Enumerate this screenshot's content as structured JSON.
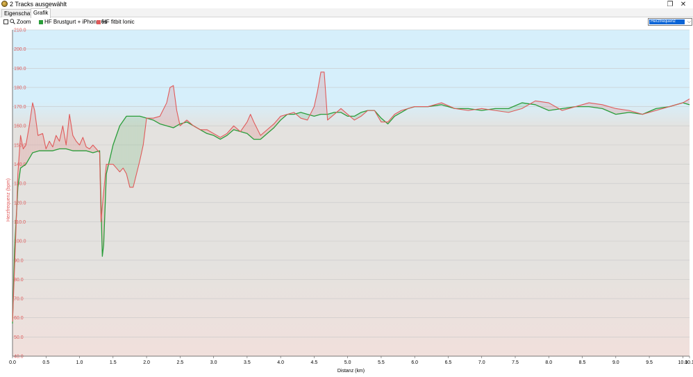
{
  "window": {
    "title": "2 Tracks ausgewählt",
    "icons": {
      "app": "gps-globe-icon",
      "maximize": "restore-window-icon",
      "close": "close-icon"
    }
  },
  "tabs": [
    {
      "label": "Eigenschaften",
      "active": false
    },
    {
      "label": "Grafik",
      "active": true
    }
  ],
  "toolbar": {
    "zoom_label": "Zoom",
    "zoom_checked": false,
    "metric_selected": "Herzfrequenz"
  },
  "colors": {
    "series1": "#2a9d3a",
    "series2": "#e05a5a",
    "band_high": "#d6effb",
    "band_mid": "#e4e2df",
    "band_low": "#f1e0dc",
    "tick_red": "#e05a5a",
    "select_blue": "#0a64d6"
  },
  "chart_data": {
    "type": "line",
    "xlabel": "Distanz  (km)",
    "ylabel": "Herzfrequenz (bpm)",
    "xlim": [
      0,
      10.1
    ],
    "ylim": [
      40,
      210
    ],
    "grid": true,
    "legend_position": "top-left",
    "x_ticks": [
      "0.0",
      "0.5",
      "1.0",
      "1.5",
      "2.0",
      "2.5",
      "3.0",
      "3.5",
      "4.0",
      "4.5",
      "5.0",
      "5.5",
      "6.0",
      "6.5",
      "7.0",
      "7.5",
      "8.0",
      "8.5",
      "9.0",
      "9.5",
      "10.0",
      "10.1"
    ],
    "y_ticks": [
      "40.0",
      "50.0",
      "60.0",
      "70.0",
      "80.0",
      "90.0",
      "100.0",
      "110.0",
      "120.0",
      "130.0",
      "140.0",
      "150.0",
      "160.0",
      "170.0",
      "180.0",
      "190.0",
      "200.0",
      "210.0"
    ],
    "x_tick_values": [
      0,
      0.5,
      1,
      1.5,
      2,
      2.5,
      3,
      3.5,
      4,
      4.5,
      5,
      5.5,
      6,
      6.5,
      7,
      7.5,
      8,
      8.5,
      9,
      9.5,
      10,
      10.1
    ],
    "y_tick_values": [
      40,
      50,
      60,
      70,
      80,
      90,
      100,
      110,
      120,
      130,
      140,
      150,
      160,
      170,
      180,
      190,
      200,
      210
    ],
    "series": [
      {
        "name": "HF Brustgurt + iPhone 6s",
        "x": [
          0,
          0.03,
          0.08,
          0.12,
          0.2,
          0.3,
          0.4,
          0.5,
          0.6,
          0.7,
          0.8,
          0.9,
          1.0,
          1.1,
          1.2,
          1.3,
          1.32,
          1.34,
          1.36,
          1.4,
          1.5,
          1.6,
          1.7,
          1.8,
          1.9,
          2.0,
          2.1,
          2.2,
          2.3,
          2.4,
          2.5,
          2.6,
          2.7,
          2.8,
          2.9,
          3.0,
          3.1,
          3.2,
          3.3,
          3.4,
          3.5,
          3.6,
          3.7,
          3.8,
          3.9,
          4.0,
          4.1,
          4.2,
          4.3,
          4.4,
          4.5,
          4.6,
          4.7,
          4.8,
          4.9,
          5.0,
          5.1,
          5.2,
          5.3,
          5.4,
          5.5,
          5.6,
          5.7,
          5.8,
          5.9,
          6.0,
          6.2,
          6.4,
          6.6,
          6.8,
          7.0,
          7.2,
          7.4,
          7.6,
          7.8,
          8.0,
          8.2,
          8.4,
          8.6,
          8.8,
          9.0,
          9.2,
          9.4,
          9.6,
          9.8,
          10.0,
          10.1
        ],
        "y": [
          57,
          95,
          128,
          138,
          140,
          146,
          147,
          147,
          147,
          148,
          148,
          147,
          147,
          147,
          146,
          147,
          120,
          92,
          98,
          135,
          150,
          160,
          165,
          165,
          165,
          164,
          163,
          161,
          160,
          159,
          161,
          162,
          160,
          158,
          156,
          155,
          153,
          155,
          158,
          157,
          156,
          153,
          153,
          156,
          159,
          163,
          166,
          166,
          167,
          166,
          165,
          166,
          166,
          167,
          167,
          165,
          165,
          167,
          168,
          168,
          164,
          161,
          165,
          167,
          169,
          170,
          170,
          171,
          169,
          169,
          168,
          169,
          169,
          172,
          171,
          168,
          169,
          170,
          170,
          169,
          166,
          167,
          166,
          169,
          170,
          172,
          171
        ]
      },
      {
        "name": "HF fitbit Ionic",
        "x": [
          0,
          0.02,
          0.05,
          0.08,
          0.12,
          0.16,
          0.2,
          0.25,
          0.3,
          0.33,
          0.38,
          0.45,
          0.5,
          0.55,
          0.6,
          0.65,
          0.7,
          0.75,
          0.8,
          0.85,
          0.9,
          0.95,
          1.0,
          1.05,
          1.1,
          1.15,
          1.2,
          1.25,
          1.3,
          1.32,
          1.35,
          1.4,
          1.45,
          1.5,
          1.55,
          1.6,
          1.65,
          1.7,
          1.75,
          1.8,
          1.85,
          1.9,
          1.95,
          2.0,
          2.1,
          2.2,
          2.3,
          2.35,
          2.4,
          2.45,
          2.5,
          2.6,
          2.7,
          2.8,
          2.9,
          3.0,
          3.1,
          3.2,
          3.3,
          3.4,
          3.5,
          3.55,
          3.6,
          3.7,
          3.8,
          3.9,
          4.0,
          4.1,
          4.2,
          4.3,
          4.4,
          4.5,
          4.55,
          4.6,
          4.65,
          4.7,
          4.8,
          4.9,
          5.0,
          5.1,
          5.2,
          5.3,
          5.4,
          5.5,
          5.6,
          5.7,
          5.8,
          5.9,
          6.0,
          6.2,
          6.4,
          6.6,
          6.8,
          7.0,
          7.2,
          7.4,
          7.6,
          7.8,
          8.0,
          8.2,
          8.4,
          8.6,
          8.8,
          9.0,
          9.2,
          9.4,
          9.6,
          9.8,
          10.0,
          10.1
        ],
        "y": [
          58,
          76,
          104,
          135,
          155,
          148,
          150,
          160,
          172,
          168,
          155,
          156,
          148,
          152,
          149,
          155,
          152,
          160,
          150,
          166,
          155,
          152,
          150,
          154,
          149,
          148,
          150,
          148,
          146,
          110,
          122,
          140,
          140,
          140,
          138,
          136,
          138,
          135,
          128,
          128,
          135,
          142,
          150,
          164,
          164,
          165,
          172,
          180,
          181,
          168,
          160,
          163,
          160,
          158,
          158,
          156,
          154,
          156,
          160,
          157,
          162,
          166,
          162,
          155,
          158,
          161,
          165,
          166,
          167,
          164,
          163,
          170,
          178,
          188,
          188,
          163,
          166,
          169,
          166,
          163,
          165,
          168,
          168,
          162,
          162,
          166,
          168,
          169,
          170,
          170,
          172,
          169,
          168,
          169,
          168,
          167,
          169,
          173,
          172,
          168,
          170,
          172,
          171,
          169,
          168,
          166,
          168,
          170,
          172,
          174
        ]
      }
    ]
  }
}
